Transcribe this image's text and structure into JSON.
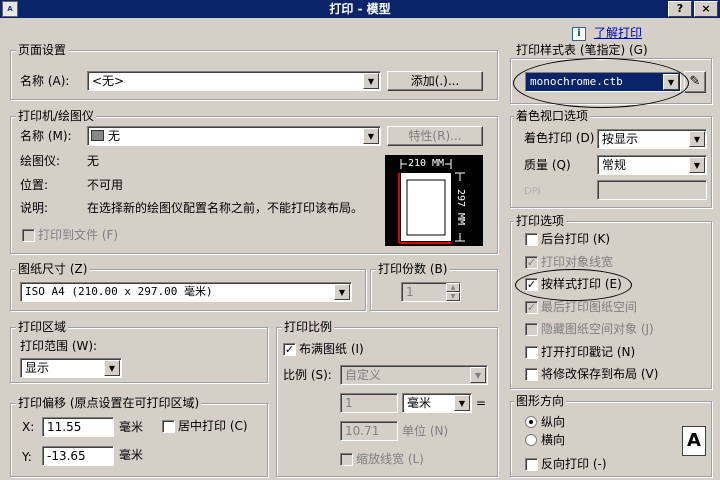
{
  "window": {
    "title": "打印 - 模型",
    "icon_text": "A",
    "help_btn": "?",
    "close_btn": "×"
  },
  "help_link": {
    "label": "了解打印",
    "icon": "i"
  },
  "page_setup": {
    "title": "页面设置",
    "name_label": "名称 (A):",
    "name_value": "<无>",
    "add_button": "添加(.)..."
  },
  "plotter": {
    "title": "打印机/绘图仪",
    "name_label": "名称 (M):",
    "name_value": "无",
    "properties_button": "特性(R)...",
    "plotter_label": "绘图仪:",
    "plotter_value": "无",
    "location_label": "位置:",
    "location_value": "不可用",
    "desc_label": "说明:",
    "desc_value": "在选择新的绘图仪配置名称之前，不能打印该布局。",
    "print_to_file": "打印到文件 (F)",
    "preview_width": "210 MM",
    "preview_height": "297 MM"
  },
  "paper_size": {
    "title": "图纸尺寸 (Z)",
    "value": "ISO A4 (210.00 x 297.00 毫米)"
  },
  "copies": {
    "title": "打印份数 (B)",
    "value": "1"
  },
  "plot_area": {
    "title": "打印区域",
    "range_label": "打印范围 (W):",
    "range_value": "显示"
  },
  "plot_offset": {
    "title": "打印偏移 (原点设置在可打印区域)",
    "x_label": "X:",
    "x_value": "11.55",
    "x_unit": "毫米",
    "center_label": "居中打印 (C)",
    "y_label": "Y:",
    "y_value": "-13.65",
    "y_unit": "毫米"
  },
  "plot_scale": {
    "title": "打印比例",
    "fit_label": "布满图纸 (I)",
    "scale_label": "比例 (S):",
    "scale_value": "自定义",
    "value1": "1",
    "unit_value": "毫米",
    "equals": "=",
    "value2": "10.71",
    "unit2_label": "单位 (N)",
    "scale_lineweights": "缩放线宽 (L)"
  },
  "style_table": {
    "title": "打印样式表 (笔指定) (G)",
    "value": "monochrome.ctb"
  },
  "shaded_viewport": {
    "title": "着色视口选项",
    "shade_label": "着色打印 (D)",
    "shade_value": "按显示",
    "quality_label": "质量 (Q)",
    "quality_value": "常规",
    "dpi_label": "DPI"
  },
  "plot_options": {
    "title": "打印选项",
    "items": [
      {
        "label": "后台打印 (K)",
        "checked": false,
        "disabled": false
      },
      {
        "label": "打印对象线宽",
        "checked": true,
        "disabled": true
      },
      {
        "label": "按样式打印 (E)",
        "checked": true,
        "disabled": false
      },
      {
        "label": "最后打印图纸空间",
        "checked": true,
        "disabled": true
      },
      {
        "label": "隐藏图纸空间对象 (J)",
        "checked": false,
        "disabled": true
      },
      {
        "label": "打开打印戳记 (N)",
        "checked": false,
        "disabled": false
      },
      {
        "label": "将修改保存到布局 (V)",
        "checked": false,
        "disabled": false
      }
    ]
  },
  "orientation": {
    "title": "图形方向",
    "portrait": "纵向",
    "landscape": "横向",
    "reverse": "反向打印 (-)",
    "icon_letter": "A"
  }
}
